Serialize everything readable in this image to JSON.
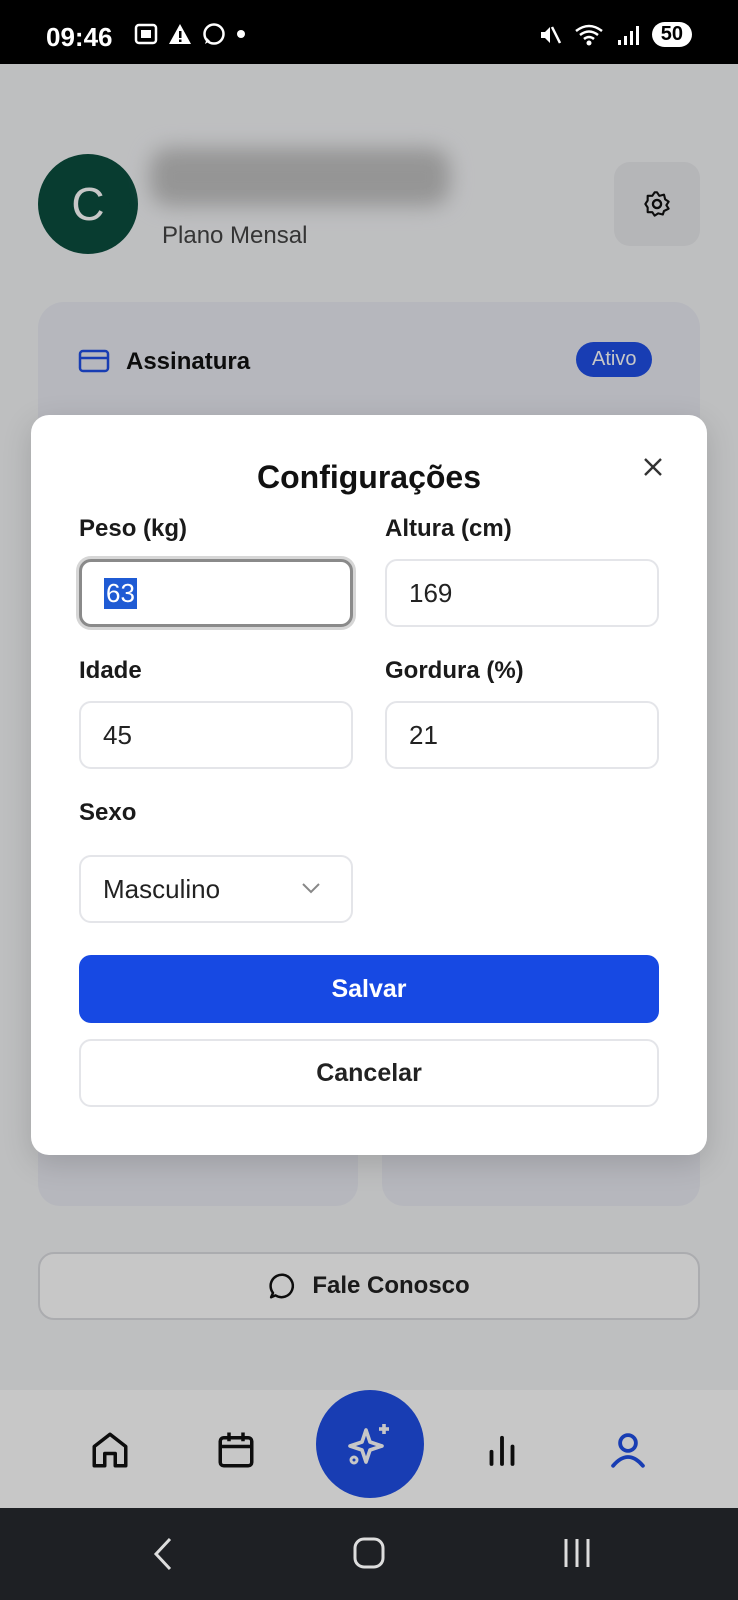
{
  "status_bar": {
    "time": "09:46",
    "battery": "50",
    "icons": [
      "screenshot-icon",
      "alert-icon",
      "whatsapp-icon",
      "dot-icon",
      "mute-icon",
      "wifi-icon",
      "signal-icon"
    ]
  },
  "profile": {
    "avatar_initial": "C",
    "plan": "Plano Mensal"
  },
  "subscription_card": {
    "title": "Assinatura",
    "badge": "Ativo"
  },
  "contact_button": {
    "label": "Fale Conosco"
  },
  "modal": {
    "title": "Configurações",
    "fields": {
      "peso": {
        "label": "Peso (kg)",
        "value": "63"
      },
      "altura": {
        "label": "Altura (cm)",
        "value": "169"
      },
      "idade": {
        "label": "Idade",
        "value": "45"
      },
      "gordura": {
        "label": "Gordura (%)",
        "value": "21"
      },
      "sexo": {
        "label": "Sexo",
        "value": "Masculino"
      }
    },
    "save_label": "Salvar",
    "cancel_label": "Cancelar"
  },
  "bottom_nav": {
    "items": [
      "home-icon",
      "calendar-icon",
      "sparkles-icon",
      "stats-icon",
      "profile-icon"
    ],
    "active": "profile-icon"
  },
  "colors": {
    "accent": "#1749e3",
    "avatar_bg": "#0b4d3e"
  }
}
